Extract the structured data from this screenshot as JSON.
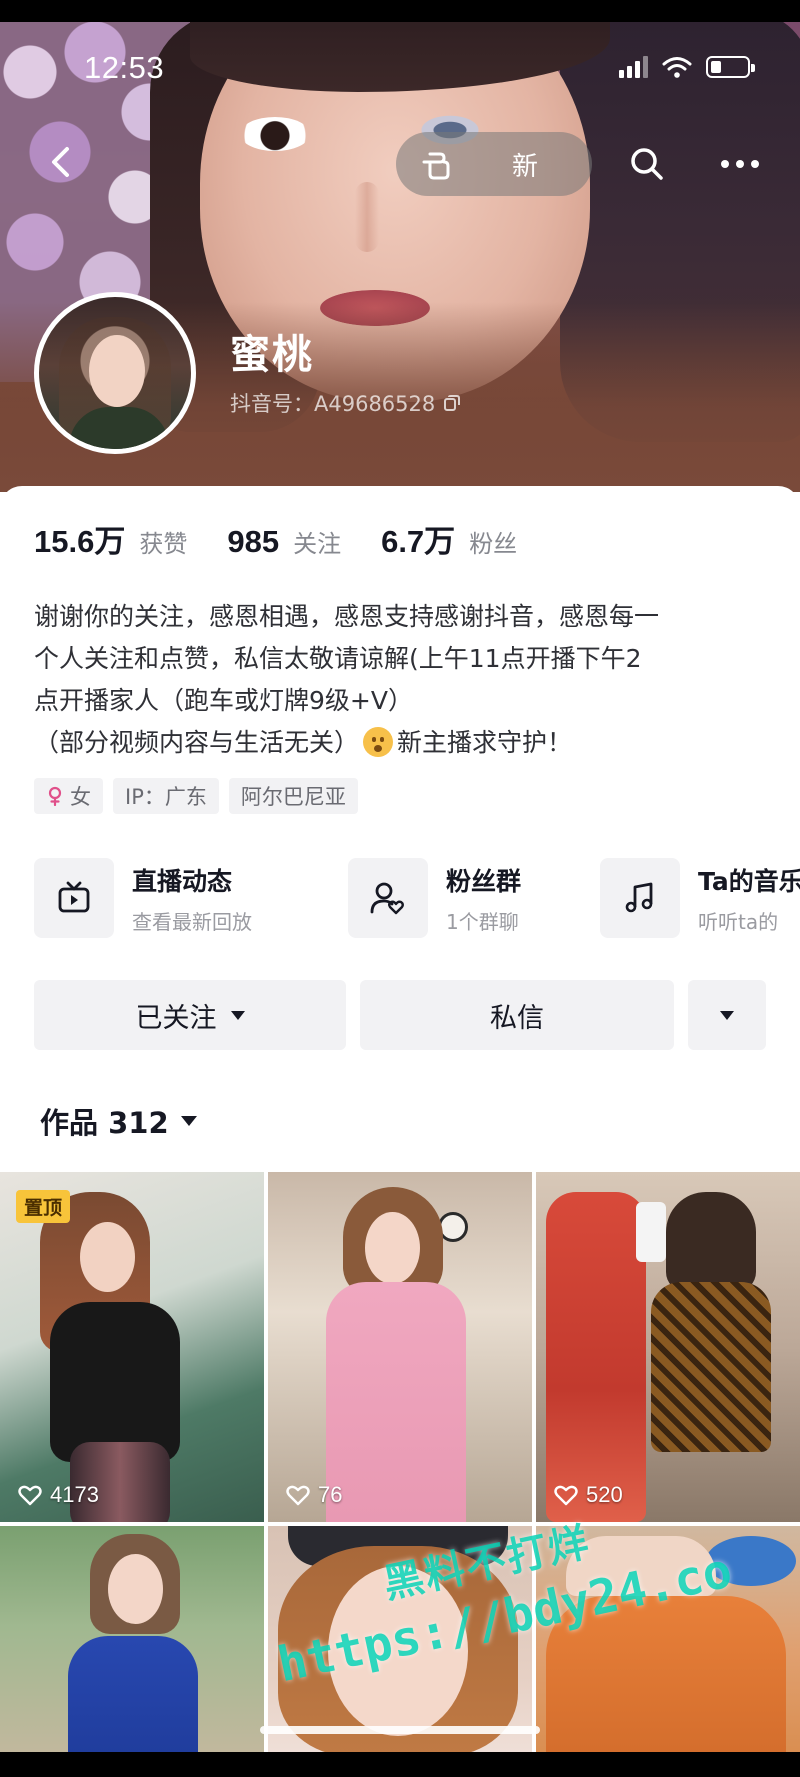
{
  "status_bar": {
    "time": "12:53"
  },
  "nav": {
    "pill_text": "新"
  },
  "profile": {
    "nickname": "蜜桃",
    "douyin_id": "抖音号：A49686528"
  },
  "stats": [
    {
      "value": "15.6万",
      "label": "获赞"
    },
    {
      "value": "985",
      "label": "关注"
    },
    {
      "value": "6.7万",
      "label": "粉丝"
    }
  ],
  "bio": {
    "line1": "谢谢你的关注，感恩相遇，感恩支持感谢抖音，感恩每一",
    "line2": "个人关注和点赞，私信太敬请谅解(上午11点开播下午2",
    "line3": "点开播家人（跑车或灯牌9级+V）",
    "line4_before": "（部分视频内容与生活无关）",
    "line4_after": "新主播求守护！"
  },
  "tags": [
    {
      "label": "女",
      "icon": "female-icon"
    },
    {
      "label": "IP：广东"
    },
    {
      "label": "阿尔巴尼亚"
    }
  ],
  "features": [
    {
      "title": "直播动态",
      "subtitle": "查看最新回放",
      "icon": "live-tv-icon"
    },
    {
      "title": "粉丝群",
      "subtitle": "1个群聊",
      "icon": "fan-group-icon"
    },
    {
      "title": "Ta的音乐",
      "subtitle": "听听ta的",
      "icon": "music-note-icon"
    }
  ],
  "actions": {
    "followed_label": "已关注",
    "message_label": "私信"
  },
  "works": {
    "label": "作品 312"
  },
  "videos": [
    {
      "likes": "4173",
      "pinned_label": "置顶"
    },
    {
      "likes": "76"
    },
    {
      "likes": "520"
    },
    {
      "likes": ""
    },
    {
      "likes": ""
    },
    {
      "likes": ""
    }
  ],
  "watermark": {
    "line1": "黑料不打烊",
    "line2": "https://bdy24.co"
  },
  "colors": {
    "accent_text": "#161823",
    "muted_text": "#86888f",
    "chip_bg": "#f2f2f4",
    "pinned_badge": "#f8c43a",
    "watermark": "#00d2b4"
  }
}
